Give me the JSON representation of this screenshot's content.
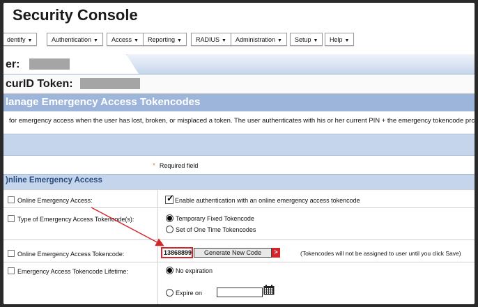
{
  "app": {
    "title": "Security Console"
  },
  "menu": [
    {
      "label": "dentify"
    },
    {
      "label": "Authentication"
    },
    {
      "label": "Access"
    },
    {
      "label": "Reporting"
    },
    {
      "label": "RADIUS"
    },
    {
      "label": "Administration"
    },
    {
      "label": "Setup"
    },
    {
      "label": "Help"
    }
  ],
  "header": {
    "user_label": "er:",
    "token_label": "curID Token:"
  },
  "page": {
    "title": "lanage Emergency Access Tokencodes",
    "description": "for emergency access when the user has lost, broken, or misplaced a token. The user authenticates with his or her current PIN + the emergency tokencode prc",
    "required_note": "Required field",
    "required_marker": "*"
  },
  "section": {
    "title": ")nline Emergency Access",
    "rows": [
      {
        "label": "Online Emergency Access:",
        "value": "Enable authentication with an online emergency access tokencode",
        "checked": true
      },
      {
        "label": "Type of Emergency Access Tokencode(s):",
        "options": [
          "Temporary Fixed Tokencode",
          "Set of One Time Tokencodes"
        ],
        "selected": "Temporary Fixed Tokencode"
      },
      {
        "label": "Online Emergency Access Tokencode:",
        "tokencode": "13868899",
        "button": "Generate New Code",
        "button_go": ">",
        "note": "(Tokencodes will not be assigned to user until you click Save)"
      },
      {
        "label": "Emergency Access Tokencode Lifetime:",
        "options": [
          "No expiration",
          "Expire on"
        ],
        "selected": "No expiration",
        "date_value": ""
      }
    ]
  },
  "colors": {
    "section_blue": "#9db5da",
    "light_blue": "#c4d5ec",
    "accent_red": "#d2262c",
    "required_orange": "#e08a2a"
  },
  "icons": {
    "checkbox": "check-icon",
    "calendar": "calendar-icon",
    "arrow": "annotation-arrow"
  }
}
